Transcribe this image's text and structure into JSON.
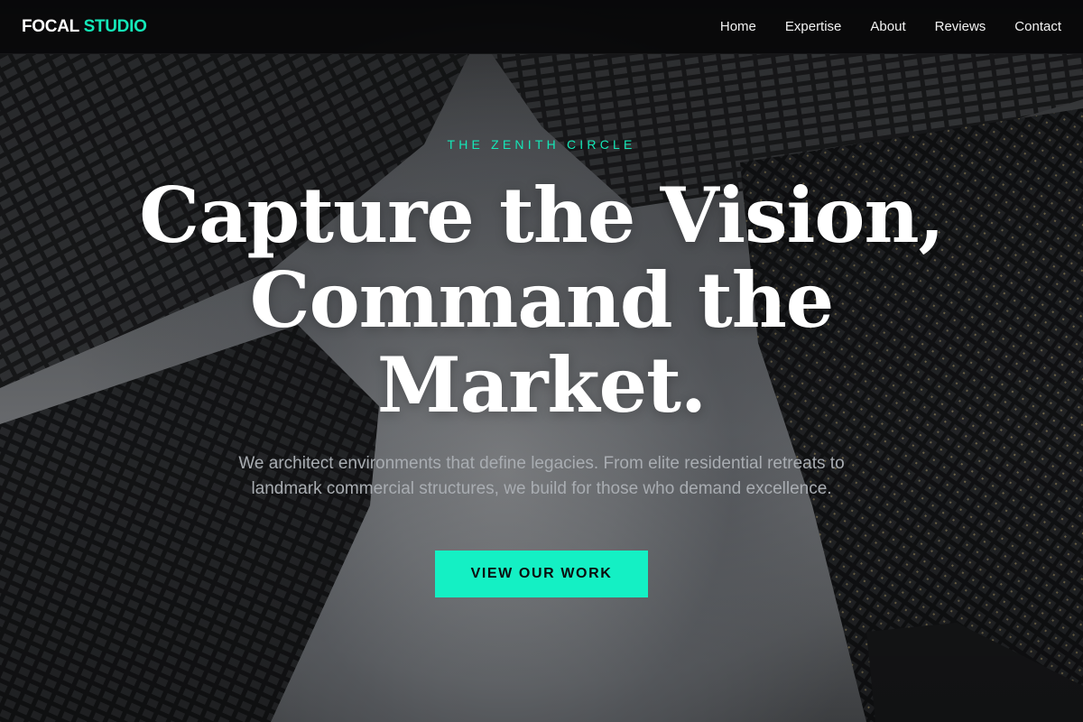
{
  "brand": {
    "name_part1": "FOCAL",
    "name_part2": "STUDIO",
    "accent_color": "#14e8b8"
  },
  "nav": {
    "items": [
      {
        "label": "Home"
      },
      {
        "label": "Expertise"
      },
      {
        "label": "About"
      },
      {
        "label": "Reviews"
      },
      {
        "label": "Contact"
      }
    ]
  },
  "hero": {
    "eyebrow": "THE ZENITH CIRCLE",
    "headline": "Capture the Vision, Command the Market.",
    "subtext": "We architect environments that define legacies. From elite residential retreats to landmark commercial structures, we build for those who demand excellence.",
    "cta_label": "VIEW OUR WORK",
    "cta_color": "#14f0c4",
    "background_image": "skyscrapers-looking-up"
  }
}
